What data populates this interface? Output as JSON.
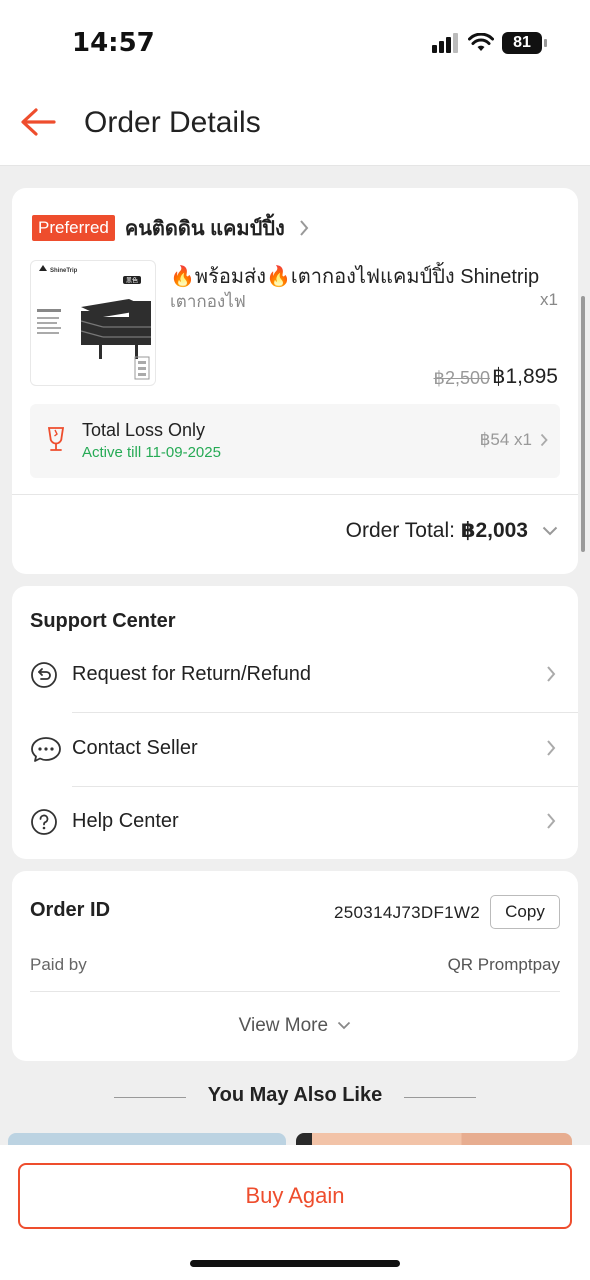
{
  "status_bar": {
    "time": "14:57",
    "battery": "81"
  },
  "header": {
    "title": "Order Details"
  },
  "shop": {
    "badge": "Preferred",
    "name": "คนติดดิน แคมป์ปิ้ง",
    "product": {
      "title": "🔥พร้อมส่ง🔥เตากองไฟแคมป์ปิ้ง Shinetrip",
      "variant": "เตากองไฟ",
      "quantity": "x1",
      "original_price": "฿2,500",
      "price": "฿1,895",
      "image_brand": "ShineTrip",
      "image_tag": "黑色"
    },
    "protection": {
      "title": "Total Loss Only",
      "active": "Active till 11-09-2025",
      "price": "฿54 x1"
    },
    "order_total_label": "Order Total:",
    "order_total_value": "฿2,003"
  },
  "support": {
    "title": "Support Center",
    "items": [
      {
        "label": "Request for Return/Refund",
        "icon": "return-icon"
      },
      {
        "label": "Contact Seller",
        "icon": "chat-icon"
      },
      {
        "label": "Help Center",
        "icon": "help-icon"
      }
    ]
  },
  "order_info": {
    "id_label": "Order ID",
    "id_value": "250314J73DF1W2",
    "copy_label": "Copy",
    "paid_label": "Paid by",
    "paid_value": "QR Promptpay",
    "view_more": "View More"
  },
  "recommendations": {
    "title": "You May Also Like"
  },
  "footer": {
    "buy_again": "Buy Again"
  },
  "colors": {
    "accent": "#ee4d2d",
    "success": "#26aa55",
    "background": "#efefef"
  }
}
